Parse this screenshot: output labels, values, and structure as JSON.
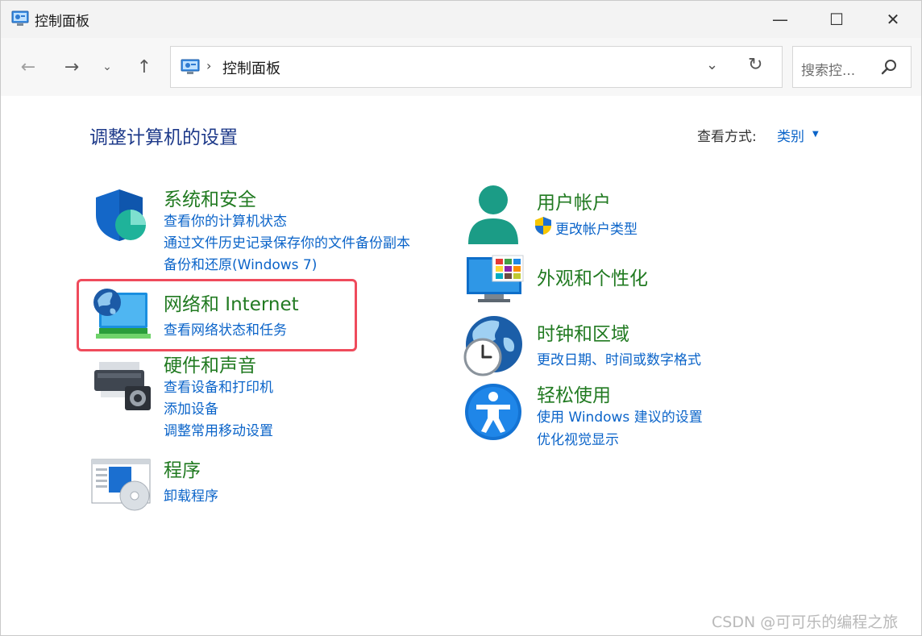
{
  "window": {
    "title": "控制面板",
    "controls": {
      "minimize": "—",
      "maximize": "☐",
      "close": "✕"
    }
  },
  "nav": {
    "back": "←",
    "forward": "→",
    "recent": "⌄",
    "up": "↑",
    "address": {
      "separator": "›",
      "path": "控制面板",
      "dropdown": "⌄",
      "refresh": "↻"
    },
    "search": {
      "placeholder": "搜索控..."
    }
  },
  "content": {
    "title": "调整计算机的设置",
    "view_by": {
      "label": "查看方式:",
      "value": "类别",
      "caret": "▼"
    },
    "categories": [
      {
        "title": "系统和安全",
        "links": [
          "查看你的计算机状态",
          "通过文件历史记录保存你的文件备份副本",
          "备份和还原(Windows 7)"
        ]
      },
      {
        "title": "网络和 Internet",
        "links": [
          "查看网络状态和任务"
        ]
      },
      {
        "title": "硬件和声音",
        "links": [
          "查看设备和打印机",
          "添加设备",
          "调整常用移动设置"
        ]
      },
      {
        "title": "程序",
        "links": [
          "卸载程序"
        ]
      },
      {
        "title": "用户帐户",
        "links": [
          "更改帐户类型"
        ]
      },
      {
        "title": "外观和个性化",
        "links": []
      },
      {
        "title": "时钟和区域",
        "links": [
          "更改日期、时间或数字格式"
        ]
      },
      {
        "title": "轻松使用",
        "links": [
          "使用 Windows 建议的设置",
          "优化视觉显示"
        ]
      }
    ]
  },
  "watermark": "CSDN @可可乐的编程之旅",
  "colors": {
    "title_blue": "#1e3a8a",
    "category_green": "#217a21",
    "link_blue": "#0b64c9",
    "highlight_red": "#ef4b5c"
  }
}
